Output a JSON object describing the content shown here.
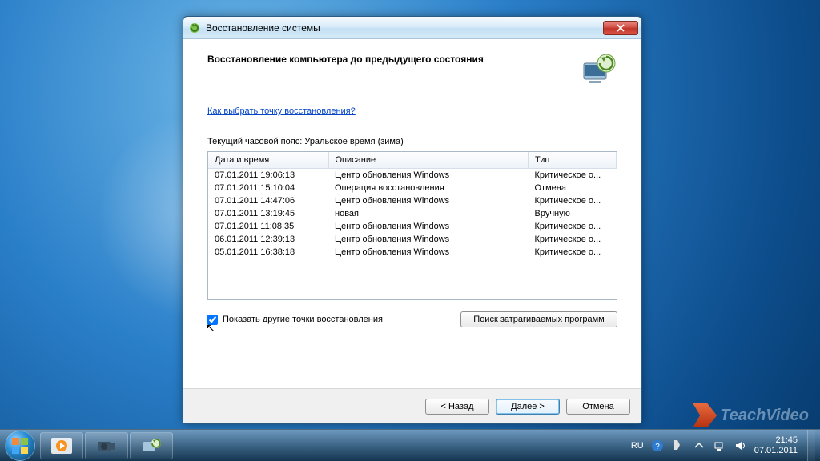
{
  "dialog": {
    "title": "Восстановление системы",
    "heading": "Восстановление компьютера до предыдущего состояния",
    "help_link": "Как выбрать точку восстановления?",
    "timezone_label": "Текущий часовой пояс: Уральское время (зима)",
    "columns": {
      "date": "Дата и время",
      "desc": "Описание",
      "type": "Тип"
    },
    "rows": [
      {
        "date": "07.01.2011 19:06:13",
        "desc": "Центр обновления Windows",
        "type": "Критическое о..."
      },
      {
        "date": "07.01.2011 15:10:04",
        "desc": "Операция восстановления",
        "type": "Отмена"
      },
      {
        "date": "07.01.2011 14:47:06",
        "desc": "Центр обновления Windows",
        "type": "Критическое о..."
      },
      {
        "date": "07.01.2011 13:19:45",
        "desc": "новая",
        "type": "Вручную"
      },
      {
        "date": "07.01.2011 11:08:35",
        "desc": "Центр обновления Windows",
        "type": "Критическое о..."
      },
      {
        "date": "06.01.2011 12:39:13",
        "desc": "Центр обновления Windows",
        "type": "Критическое о..."
      },
      {
        "date": "05.01.2011 16:38:18",
        "desc": "Центр обновления Windows",
        "type": "Критическое о..."
      }
    ],
    "show_more_checkbox": "Показать другие точки восстановления",
    "affected_btn": "Поиск затрагиваемых программ",
    "buttons": {
      "back": "< Назад",
      "next": "Далее >",
      "cancel": "Отмена"
    }
  },
  "taskbar": {
    "language": "RU",
    "time": "21:45",
    "date": "07.01.2011"
  },
  "watermark": {
    "text": "TeachVideo"
  }
}
